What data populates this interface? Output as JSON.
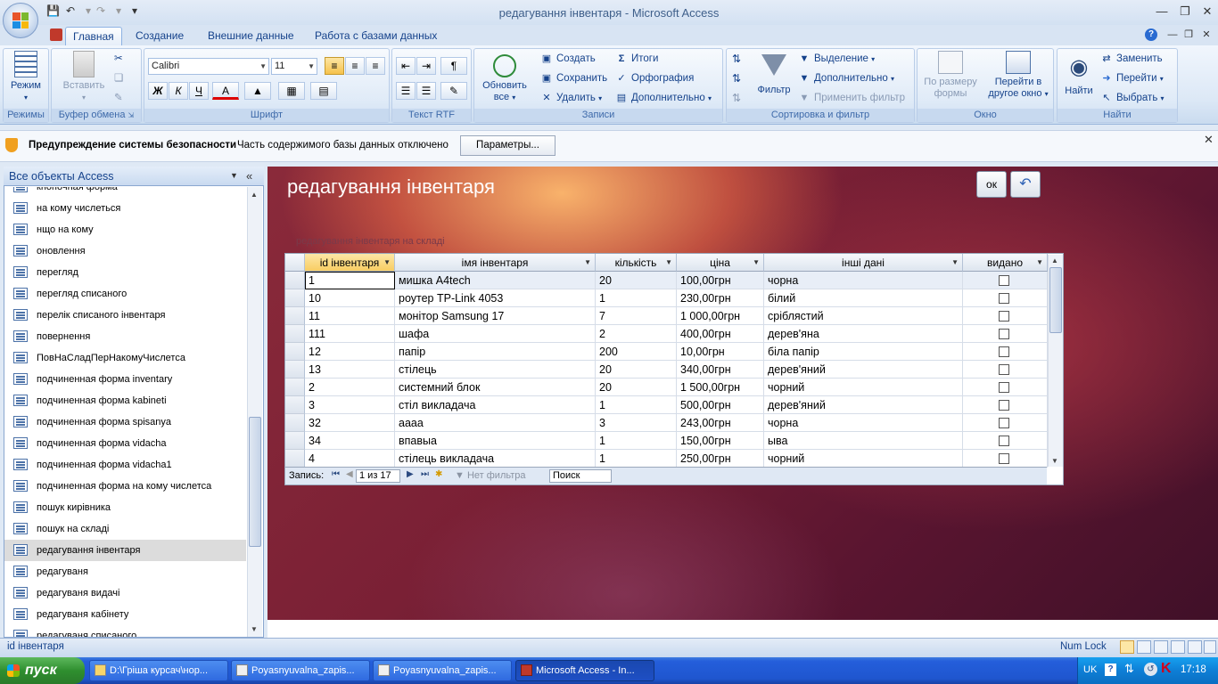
{
  "window": {
    "title": "редагування інвентаря - Microsoft Access"
  },
  "tabs": [
    "Главная",
    "Создание",
    "Внешние данные",
    "Работа с базами данных"
  ],
  "ribbon": {
    "rezhimy": {
      "label": "Режимы",
      "btn": "Режим"
    },
    "bufer": {
      "label": "Буфер обмена",
      "paste": "Вставить"
    },
    "shrift": {
      "label": "Шрифт",
      "font": "Calibri",
      "size": "11",
      "bold": "Ж",
      "italic": "К",
      "underline": "Ч",
      "color": "A"
    },
    "tekst": {
      "label": "Текст RTF"
    },
    "zapisi": {
      "label": "Записи",
      "refresh1": "Обновить",
      "refresh2": "все",
      "create": "Создать",
      "save": "Сохранить",
      "delete": "Удалить",
      "totals": "Итоги",
      "spelling": "Орфография",
      "more": "Дополнительно"
    },
    "sort": {
      "label": "Сортировка и фильтр",
      "filter": "Фильтр",
      "selection": "Выделение",
      "advanced": "Дополнительно",
      "apply": "Применить фильтр"
    },
    "okno": {
      "label": "Окно",
      "fit1": "По размеру",
      "fit2": "формы",
      "switch1": "Перейти в",
      "switch2": "другое окно"
    },
    "nayti": {
      "label": "Найти",
      "find": "Найти",
      "replace": "Заменить",
      "goto": "Перейти",
      "select": "Выбрать"
    }
  },
  "security": {
    "title": "Предупреждение системы безопасности",
    "text": "Часть содержимого базы данных отключено",
    "button": "Параметры..."
  },
  "nav": {
    "header": "Все объекты Access",
    "items": [
      "кнопочная форма",
      "на кому числеться",
      "нщо на кому",
      "оновлення",
      "перегляд",
      "перегляд списаного",
      "перелік списаного інвентаря",
      "повернення",
      "ПовНаСладПерНакомуЧислетса",
      "подчиненная форма inventary",
      "подчиненная форма kabineti",
      "подчиненная форма spisanya",
      "подчиненная форма vidacha",
      "подчиненная форма vidacha1",
      "подчиненная форма на кому числетса",
      "пошук кирівника",
      "пошук на складі",
      "редагування інвентаря",
      "редагуваня",
      "редагуваня видачі",
      "редагуваня кабінету",
      "редагуваня списаного"
    ]
  },
  "form": {
    "title": "редагування інвентаря",
    "ok_label": "ок",
    "subtitle": "редагування інвентаря на складі",
    "columns": [
      "id інвентаря",
      "імя інвентаря",
      "кількість",
      "ціна",
      "інші дані",
      "видано"
    ],
    "rows": [
      [
        "1",
        "мишка A4tech",
        "20",
        "100,00грн",
        "чорна"
      ],
      [
        "10",
        "роутер TP-Link 4053",
        "1",
        "230,00грн",
        "білий"
      ],
      [
        "11",
        "монітор Samsung 17",
        "7",
        "1 000,00грн",
        "сріблястий"
      ],
      [
        "111",
        "шафа",
        "2",
        "400,00грн",
        "дерев'яна"
      ],
      [
        "12",
        "папір",
        "200",
        "10,00грн",
        "біла папір"
      ],
      [
        "13",
        "стілець",
        "20",
        "340,00грн",
        "дерев'яний"
      ],
      [
        "2",
        "системний блок",
        "20",
        "1 500,00грн",
        "чорний"
      ],
      [
        "3",
        "стіл викладача",
        "1",
        "500,00грн",
        "дерев'яний"
      ],
      [
        "32",
        "аааа",
        "3",
        "243,00грн",
        "чорна"
      ],
      [
        "34",
        "впавыа",
        "1",
        "150,00грн",
        "ыва"
      ],
      [
        "4",
        "стілець викладача",
        "1",
        "250,00грн",
        "чорний"
      ]
    ],
    "recnav": {
      "label": "Запись:",
      "position": "1 из 17",
      "nofilter": "Нет фильтра",
      "search": "Поиск"
    }
  },
  "status": {
    "left": "id інвентаря",
    "numlock": "Num Lock"
  },
  "taskbar": {
    "start": "пуск",
    "items": [
      "D:\\Гріша курсач\\нор...",
      "Poyasnyuvalna_zapis...",
      "Poyasnyuvalna_zapis...",
      "Microsoft Access - In..."
    ],
    "lang": "UK",
    "clock": "17:18"
  }
}
